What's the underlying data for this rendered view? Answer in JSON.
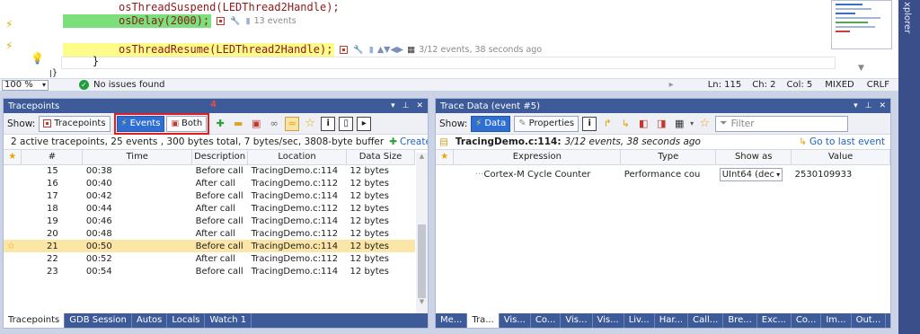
{
  "editor": {
    "lines": [
      {
        "code": "osThreadSuspend(LEDThread2Handle);"
      },
      {
        "code_highlight": "osDelay(2000);",
        "ann": "13 events"
      },
      {
        "code_highlight": "osThreadResume(LEDThread2Handle);",
        "ann": "3/12 events, 38 seconds ago"
      },
      {
        "code": "    }"
      },
      {
        "code": "}"
      }
    ],
    "zoom": "100 %",
    "issues": "No issues found",
    "status": {
      "ln": "Ln: 115",
      "ch": "Ch: 2",
      "col": "Col: 5",
      "mode": "MIXED",
      "eol": "CRLF"
    }
  },
  "right_strip": {
    "label": "xplorer"
  },
  "tracepoints": {
    "title": "Tracepoints",
    "show_label": "Show:",
    "btn_tracepoints": "Tracepoints",
    "btn_events": "Events",
    "btn_both": "Both",
    "badge": "4",
    "summary": "2 active tracepoints, 25 events , 300 bytes total, 7 bytes/sec, 3808-byte buffer",
    "create": "Create a Ne",
    "columns": [
      "#",
      "Time",
      "Description",
      "Location",
      "Data Size"
    ],
    "rows": [
      {
        "n": "15",
        "t": "00:38",
        "d": "Before call",
        "l": "TracingDemo.c:114",
        "s": "12 bytes"
      },
      {
        "n": "16",
        "t": "00:40",
        "d": "After call",
        "l": "TracingDemo.c:112",
        "s": "12 bytes"
      },
      {
        "n": "17",
        "t": "00:42",
        "d": "Before call",
        "l": "TracingDemo.c:114",
        "s": "12 bytes"
      },
      {
        "n": "18",
        "t": "00:44",
        "d": "After call",
        "l": "TracingDemo.c:112",
        "s": "12 bytes"
      },
      {
        "n": "19",
        "t": "00:46",
        "d": "Before call",
        "l": "TracingDemo.c:114",
        "s": "12 bytes"
      },
      {
        "n": "20",
        "t": "00:48",
        "d": "After call",
        "l": "TracingDemo.c:112",
        "s": "12 bytes"
      },
      {
        "n": "21",
        "t": "00:50",
        "d": "Before call",
        "l": "TracingDemo.c:114",
        "s": "12 bytes"
      },
      {
        "n": "22",
        "t": "00:52",
        "d": "After call",
        "l": "TracingDemo.c:112",
        "s": "12 bytes"
      },
      {
        "n": "23",
        "t": "00:54",
        "d": "Before call",
        "l": "TracingDemo.c:114",
        "s": "12 bytes"
      }
    ],
    "tabs": [
      "Tracepoints",
      "GDB Session",
      "Autos",
      "Locals",
      "Watch 1"
    ]
  },
  "trace": {
    "title": "Trace Data (event #5)",
    "show_label": "Show:",
    "btn_data": "Data",
    "btn_props": "Properties",
    "filter_placeholder": "Filter",
    "location": "TracingDemo.c:114:",
    "location_detail": "3/12 events, 38 seconds ago",
    "goto": "Go to last event",
    "columns": [
      "Expression",
      "Type",
      "Show as",
      "Value"
    ],
    "row": {
      "expr": "Cortex-M Cycle Counter",
      "type": "Performance cou",
      "showas": "UInt64 (dec",
      "value": "2530109933"
    },
    "tabs": [
      "Me...",
      "Tra...",
      "Vis...",
      "Co...",
      "Vis...",
      "Vis...",
      "Liv...",
      "Har...",
      "Call...",
      "Bre...",
      "Exc...",
      "Co...",
      "Im...",
      "Out..."
    ]
  }
}
